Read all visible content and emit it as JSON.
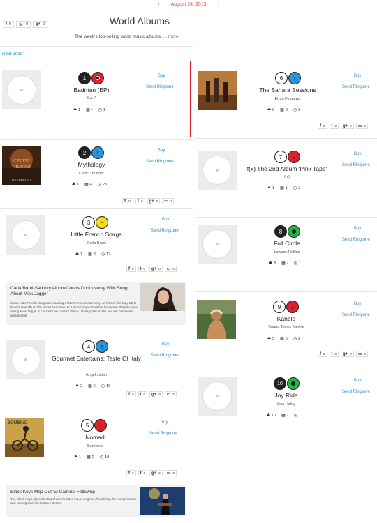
{
  "header": {
    "date": "August 24, 2013",
    "prev_arrow": "‹",
    "next_arrow": "›",
    "title": "World Albums",
    "description": "The week's top-selling world music albums, ...",
    "more": "more",
    "next_chart": "Next chart",
    "shares": [
      {
        "icon": "f",
        "count": "0"
      },
      {
        "icon": "t",
        "count": "0"
      },
      {
        "icon": "g+",
        "count": "0"
      }
    ]
  },
  "labels": {
    "buy": "Buy",
    "send_ringtone": "Send Ringtone"
  },
  "albums": [
    {
      "rank": "1",
      "move": "new",
      "title": "Badman (EP)",
      "artist": "B.A.P.",
      "likes": "1",
      "weeks": "-",
      "peak": "1"
    },
    {
      "rank": "2",
      "move": "up",
      "title": "Mythology",
      "artist": "Celtic Thunder",
      "likes": "1",
      "weeks": "4",
      "peak": "25",
      "shares": [
        "19",
        "9",
        "0",
        "1"
      ]
    },
    {
      "rank": "3",
      "move": "same",
      "title": "Little French Songs",
      "artist": "Carla Bruni",
      "likes": "1",
      "weeks": "3",
      "peak": "17",
      "shares": [
        "0",
        "0",
        "0",
        "0"
      ]
    },
    {
      "rank": "4",
      "move": "up",
      "title": "Gourmet Entertains: Taste Of Italy",
      "artist": "Angel Julian",
      "likes": "2",
      "weeks": "6",
      "peak": "16",
      "shares": [
        "0",
        "0",
        "0",
        "0"
      ]
    },
    {
      "rank": "5",
      "move": "down",
      "title": "Nomad",
      "artist": "Bombino",
      "likes": "1",
      "weeks": "2",
      "peak": "19",
      "shares": [
        "0",
        "0",
        "2",
        "0"
      ]
    },
    {
      "rank": "6",
      "move": "up",
      "title": "The Sahara Sessions",
      "artist": "Etran Finatawa",
      "likes": "6",
      "weeks": "8",
      "peak": "2",
      "shares": [
        "0",
        "0",
        "0",
        "0"
      ]
    },
    {
      "rank": "7",
      "move": "down",
      "title": "f(x) The 2nd Album 'Pink Tape'",
      "artist": "f(x)",
      "likes": "1",
      "weeks": "1",
      "peak": "2"
    },
    {
      "rank": "8",
      "move": "re",
      "title": "Full Circle",
      "artist": "Lawson Rollins",
      "likes": "8",
      "weeks": "-",
      "peak": "1"
    },
    {
      "rank": "9",
      "move": "down",
      "title": "Kahele",
      "artist": "Kuana Torres Kahele",
      "likes": "5",
      "weeks": "5",
      "peak": "2",
      "shares": [
        "0",
        "0",
        "0",
        "0"
      ]
    },
    {
      "rank": "10",
      "move": "re",
      "title": "Joy Ride",
      "artist": "Lisa Haley",
      "likes": "10",
      "weeks": "-",
      "peak": "1"
    }
  ],
  "news": [
    {
      "headline": "Carla Bruni-Sarkozy Album Courts Controversy With Song About Mick Jagger",
      "body": "Some Little French Songs are causing a little French controversy, as former first lady Carla Bruni's new album hits stores tomorrow. In it, Bruni sings about her bohemian lifestyle while dating Mick Jagger in \"At Keith and Anita's Place,\" takes political jabs and her husband's presidential"
    },
    {
      "headline": "Black Keys Map Out 'El Camino' Followup",
      "body": "The Black Keys played a stint of recent dates in Los Angeles, headlining the Honda Center and two nights at the Staples Center."
    }
  ],
  "colors": {
    "link": "#2a8ac9",
    "accent_red": "#e01b24",
    "up": "#2a95d6",
    "down": "#e0202c",
    "same": "#f2dc1d",
    "re": "#1db84a"
  }
}
